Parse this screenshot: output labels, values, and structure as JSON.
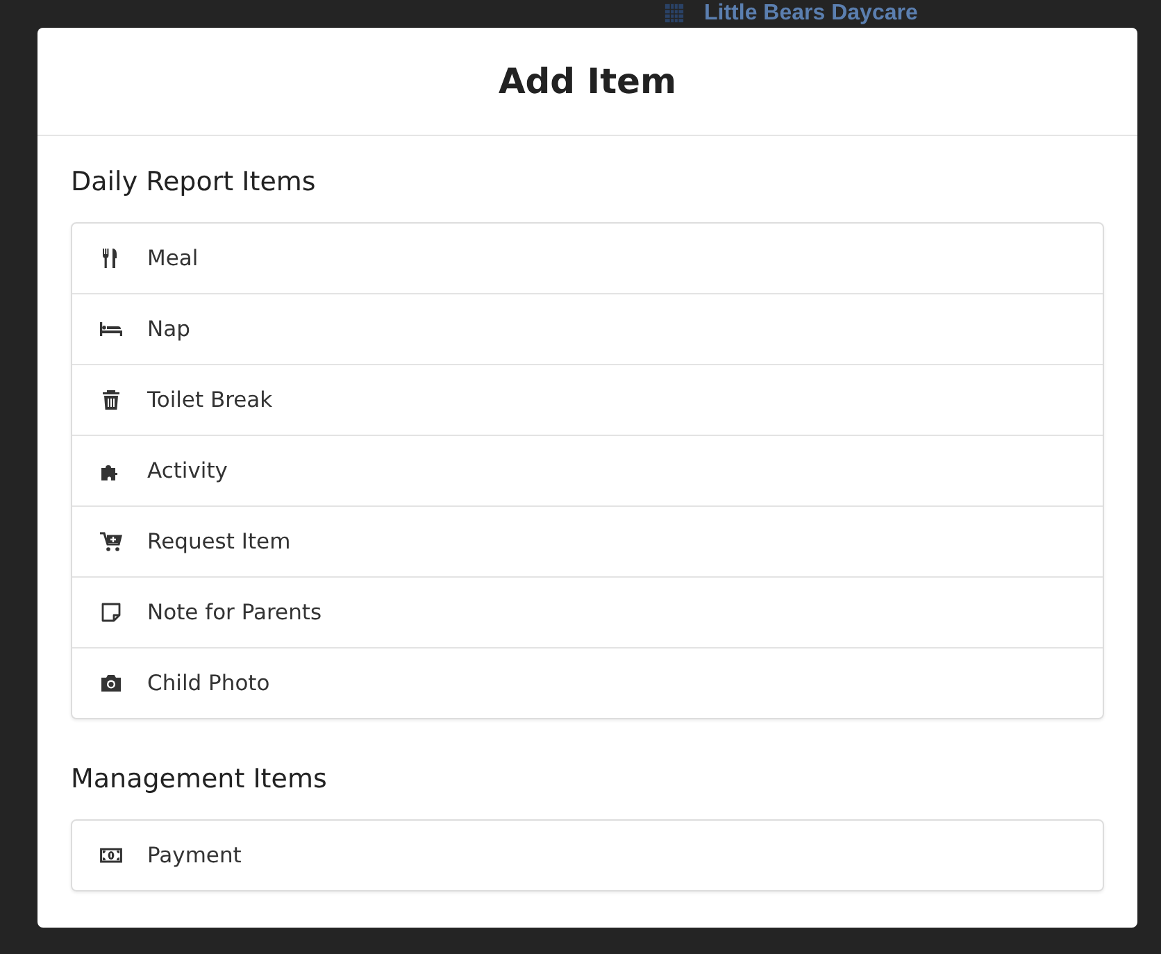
{
  "background": {
    "title": "Little Bears Daycare"
  },
  "modal": {
    "title": "Add Item",
    "sections": [
      {
        "heading": "Daily Report Items",
        "items": [
          {
            "kind": "meal",
            "label": "Meal"
          },
          {
            "kind": "nap",
            "label": "Nap"
          },
          {
            "kind": "toilet",
            "label": "Toilet Break"
          },
          {
            "kind": "activity",
            "label": "Activity"
          },
          {
            "kind": "request",
            "label": "Request Item"
          },
          {
            "kind": "note",
            "label": "Note for Parents"
          },
          {
            "kind": "photo",
            "label": "Child Photo"
          }
        ]
      },
      {
        "heading": "Management Items",
        "items": [
          {
            "kind": "payment",
            "label": "Payment"
          }
        ]
      }
    ]
  }
}
